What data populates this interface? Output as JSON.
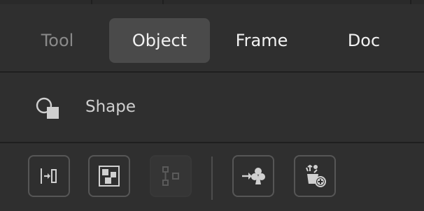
{
  "tabs": [
    {
      "label": "Tool",
      "state": "inactive"
    },
    {
      "label": "Object",
      "state": "selected"
    },
    {
      "label": "Frame",
      "state": "normal"
    },
    {
      "label": "Doc",
      "state": "normal"
    }
  ],
  "section": {
    "icon": "shape-icon",
    "label": "Shape"
  },
  "toolbar": {
    "buttons": [
      {
        "icon": "align-to-edge-icon",
        "enabled": true
      },
      {
        "icon": "arrange-grid-icon",
        "enabled": true
      },
      {
        "icon": "distribute-icon",
        "enabled": false
      },
      {
        "icon": "add-to-symbol-icon",
        "enabled": true
      },
      {
        "icon": "add-component-icon",
        "enabled": true
      }
    ]
  },
  "colors": {
    "background": "#2f2f2f",
    "selected_tab": "#4a4a4a",
    "divider": "#1f1f1f",
    "text": "#f2f2f2",
    "muted_text": "#8a8a8a"
  }
}
